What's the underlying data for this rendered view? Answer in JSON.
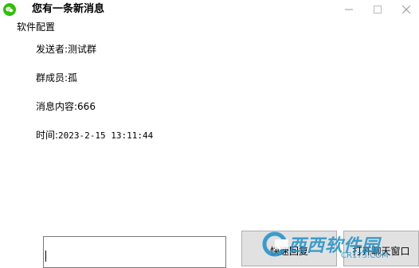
{
  "window": {
    "title": "您有一条新消息",
    "controls": {
      "minimize": "—",
      "maximize": "□",
      "close": "✕"
    }
  },
  "menu": {
    "items": [
      {
        "label": "软件配置"
      }
    ]
  },
  "message": {
    "sender": "发送者:测试群",
    "members": "群成员:孤",
    "content": "消息内容:666",
    "time_label": "时间:",
    "time_value": "2023-2-15 13:11:44"
  },
  "reply": {
    "value": ""
  },
  "buttons": {
    "send": "快速回复",
    "open": "打开聊天窗口"
  },
  "watermark": {
    "text": "西西软件园",
    "url": "CR173.COM"
  },
  "colors": {
    "app_icon": "#2dc100",
    "watermark": "#1e90c8",
    "button_bg": "#e1e1e1"
  }
}
